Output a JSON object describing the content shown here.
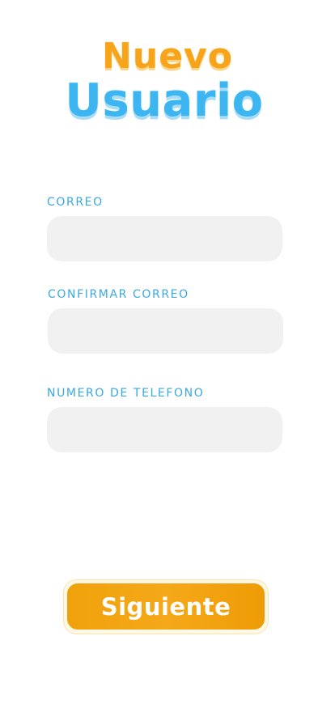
{
  "header": {
    "title_line1": "Nuevo",
    "title_line2": "Usuario"
  },
  "form": {
    "email_label": "CORREO",
    "email_value": "",
    "confirm_email_label": "CONFIRMAR CORREO",
    "confirm_email_value": "",
    "phone_label": "NUMERO DE TELEFONO",
    "phone_value": ""
  },
  "actions": {
    "next_label": "Siguiente"
  },
  "colors": {
    "title_orange": "#f7a41a",
    "title_blue": "#3db5f0",
    "label_blue": "#3aa9e0",
    "input_bg": "#f1f1f1",
    "button_orange": "#f0a20c"
  }
}
